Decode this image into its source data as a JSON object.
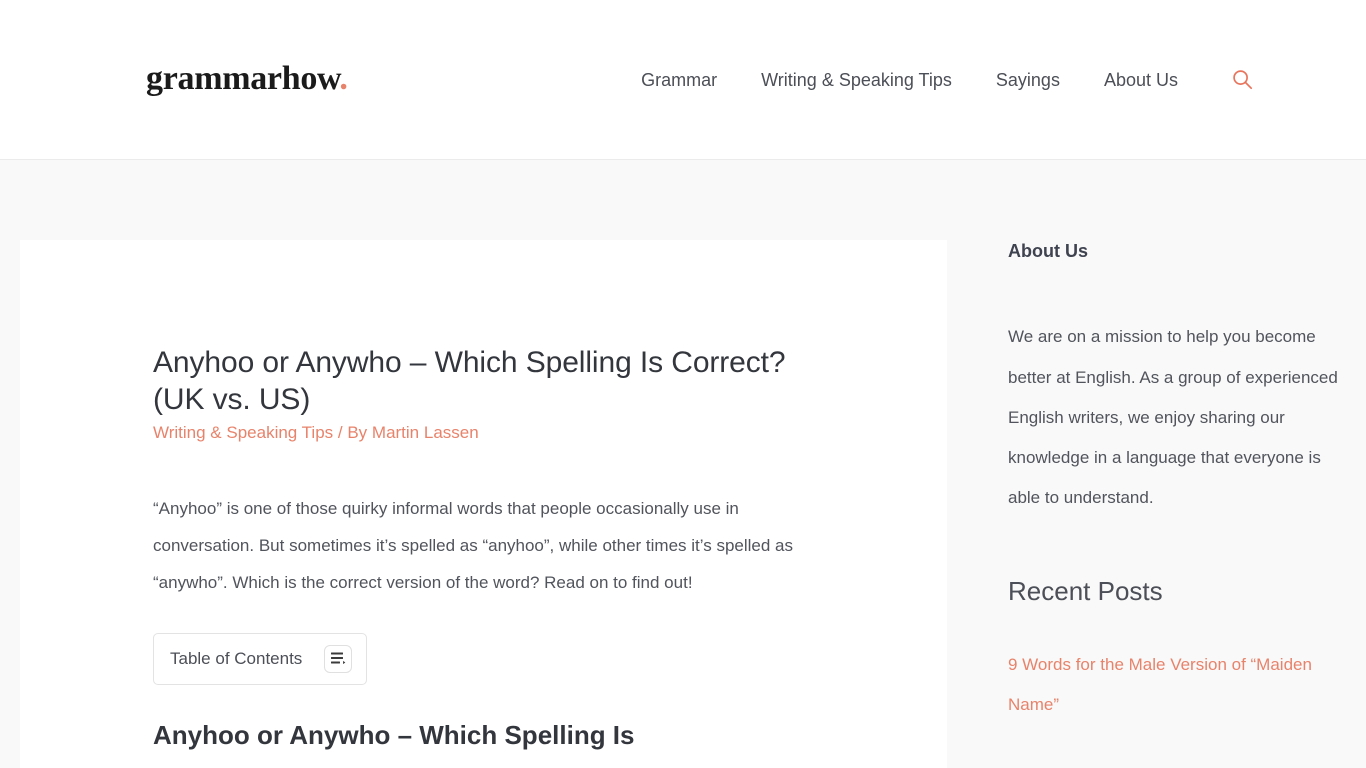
{
  "header": {
    "logo_text": "grammarhow",
    "logo_dot": ".",
    "nav": [
      {
        "label": "Grammar",
        "name": "nav-item-grammar"
      },
      {
        "label": "Writing & Speaking Tips",
        "name": "nav-item-writing-speaking-tips"
      },
      {
        "label": "Sayings",
        "name": "nav-item-sayings"
      },
      {
        "label": "About Us",
        "name": "nav-item-about-us"
      }
    ],
    "search_icon": "search-icon"
  },
  "article": {
    "title": "Anyhoo or Anywho – Which Spelling Is Correct? (UK vs. US)",
    "category": "Writing & Speaking Tips",
    "meta_separator": "/",
    "byline": "By Martin Lassen",
    "paragraph": "“Anyhoo” is one of those quirky informal words that people occasionally use in conversation. But sometimes it’s spelled as “anyhoo”, while other times it’s spelled as “anywho”. Which is the correct version of the word? Read on to find out!",
    "toc": {
      "label": "Table of Contents",
      "toggle_icon": "list-menu-icon"
    },
    "next_heading": "Anyhoo or Anywho – Which Spelling Is"
  },
  "sidebar": {
    "about": {
      "title": "About Us",
      "text": "We are on a mission to help you become better at English. As a group of experienced English writers, we enjoy sharing our knowledge in a language that everyone is able to understand."
    },
    "recent": {
      "title": "Recent Posts",
      "posts": [
        {
          "label": "9 Words for the Male Version of “Maiden Name”"
        }
      ]
    }
  },
  "colors": {
    "accent": "#e8836b",
    "text": "#51545c",
    "heading": "#33363d",
    "page_bg": "#f9f9f9",
    "card_bg": "#ffffff",
    "border": "#ebebeb"
  }
}
